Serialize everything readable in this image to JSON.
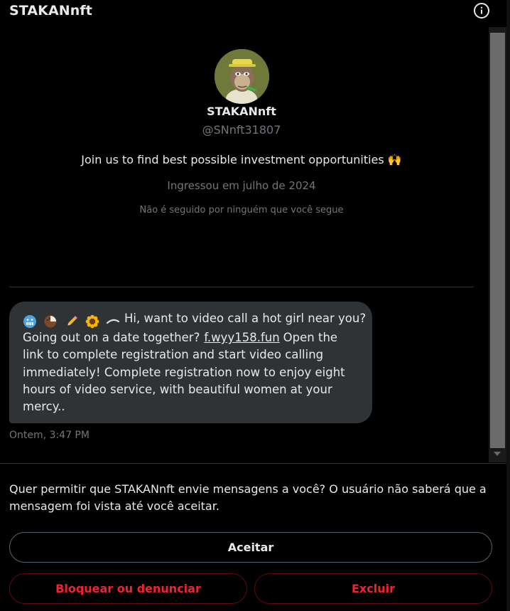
{
  "header": {
    "title": "STAKANnft",
    "info_icon": "info-icon"
  },
  "profile": {
    "avatar_icon": "bored-ape-avatar",
    "name": "STAKANnft",
    "handle": "@SNnft31807",
    "bio": "Join us to find best possible investment opportunities 🙌",
    "joined": "Ingressou em julho de 2024",
    "followers_note": "Não é seguido por ninguém que você segue"
  },
  "message": {
    "emojis": [
      "cold-face-emoji",
      "coconut-emoji",
      "pencil-emoji",
      "sunflower-emoji",
      "eyebrow-emoji"
    ],
    "line1": "Hi, want to video call a hot girl near you?",
    "line2_before": "Going out on a date together?",
    "link": "f.wyy158.fun",
    "line2_after": "Open the",
    "line3": "link to complete registration and start video calling",
    "line4": "immediately! Complete registration now to enjoy eight",
    "line5": "hours of video service, with beautiful women at your",
    "line6": "mercy..",
    "timestamp": "Ontem, 3:47 PM"
  },
  "request": {
    "text": "Quer permitir que STAKANnft envie mensagens a você? O usuário não saberá que a mensagem foi vista até você aceitar.",
    "accept_label": "Aceitar",
    "block_label": "Bloquear ou denunciar",
    "delete_label": "Excluir"
  },
  "colors": {
    "background": "#000000",
    "bubble": "#2f3336",
    "muted_text": "#71767b",
    "danger": "#f4212e"
  }
}
